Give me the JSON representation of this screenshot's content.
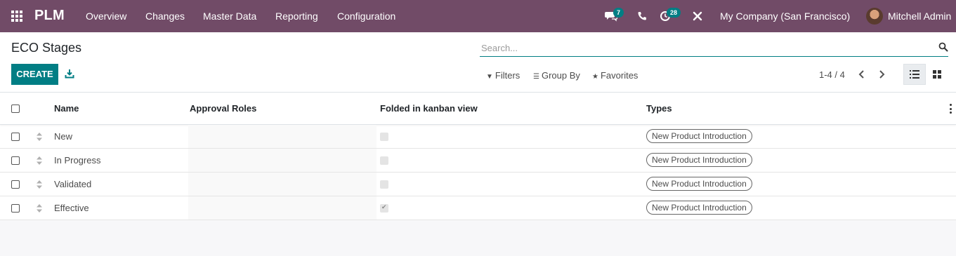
{
  "navbar": {
    "brand": "PLM",
    "menu": [
      "Overview",
      "Changes",
      "Master Data",
      "Reporting",
      "Configuration"
    ],
    "messages_count": "7",
    "activities_count": "28",
    "company": "My Company (San Francisco)",
    "user": "Mitchell Admin",
    "color": "#714b67"
  },
  "control_panel": {
    "title": "ECO Stages",
    "create_label": "CREATE",
    "search_placeholder": "Search...",
    "filters_label": "Filters",
    "group_by_label": "Group By",
    "favorites_label": "Favorites",
    "pager": "1-4 / 4",
    "accent_color": "#017e84"
  },
  "table": {
    "headers": {
      "name": "Name",
      "approval_roles": "Approval Roles",
      "folded": "Folded in kanban view",
      "types": "Types"
    },
    "rows": [
      {
        "name": "New",
        "approval_roles": "",
        "folded": false,
        "type": "New Product Introduction"
      },
      {
        "name": "In Progress",
        "approval_roles": "",
        "folded": false,
        "type": "New Product Introduction"
      },
      {
        "name": "Validated",
        "approval_roles": "",
        "folded": false,
        "type": "New Product Introduction"
      },
      {
        "name": "Effective",
        "approval_roles": "",
        "folded": true,
        "type": "New Product Introduction"
      }
    ]
  }
}
